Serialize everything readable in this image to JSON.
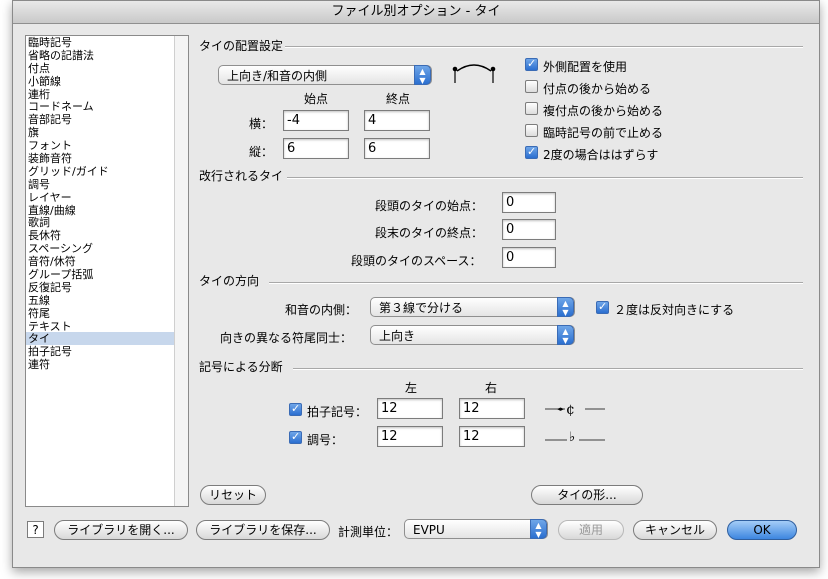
{
  "window": {
    "title": "ファイル別オプション - タイ"
  },
  "sidebar": {
    "items": [
      "臨時記号",
      "省略の記譜法",
      "付点",
      "小節線",
      "連桁",
      "コードネーム",
      "音部記号",
      "旗",
      "フォント",
      "装飾音符",
      "グリッド/ガイド",
      "調号",
      "レイヤー",
      "直線/曲線",
      "歌詞",
      "長休符",
      "スペーシング",
      "音符/休符",
      "グループ括弧",
      "反復記号",
      "五線",
      "符尾",
      "テキスト",
      "タイ",
      "拍子記号",
      "連符"
    ],
    "selected": "タイ"
  },
  "placement": {
    "title": "タイの配置設定",
    "popup_value": "上向き/和音の内側",
    "col_start": "始点",
    "col_end": "終点",
    "row_h": "横：",
    "row_v": "縦：",
    "h_start": "-4",
    "h_end": "4",
    "v_start": "6",
    "v_end": "6",
    "checks": [
      {
        "label": "外側配置を使用",
        "checked": true
      },
      {
        "label": "付点の後から始める",
        "checked": false
      },
      {
        "label": "複付点の後から始める",
        "checked": false
      },
      {
        "label": "臨時記号の前で止める",
        "checked": false
      },
      {
        "label": "2度の場合ははずらす",
        "checked": true
      }
    ]
  },
  "broken": {
    "title": "改行されるタイ",
    "start_label": "段頭のタイの始点：",
    "start_value": "0",
    "end_label": "段末のタイの終点：",
    "end_value": "0",
    "space_label": "段頭のタイのスペース：",
    "space_value": "0"
  },
  "direction": {
    "title": "タイの方向",
    "inner_label": "和音の内側：",
    "inner_value": "第３線で分ける",
    "stem_label": "向きの異なる符尾同士：",
    "stem_value": "上向き",
    "flip_label": "２度は反対向きにする",
    "flip_checked": true
  },
  "analysis": {
    "title": "記号による分断",
    "col_left": "左",
    "col_right": "右",
    "time_label": "拍子記号：",
    "time_checked": true,
    "time_left": "12",
    "time_right": "12",
    "key_label": "調号：",
    "key_checked": true,
    "key_left": "12",
    "key_right": "12"
  },
  "buttons": {
    "reset": "リセット",
    "tie_shape": "タイの形...",
    "help": "?",
    "open_library": "ライブラリを開く...",
    "save_library": "ライブラリを保存...",
    "units_label": "計測単位：",
    "units_value": "EVPU",
    "apply": "適用",
    "cancel": "キャンセル",
    "ok": "OK"
  }
}
